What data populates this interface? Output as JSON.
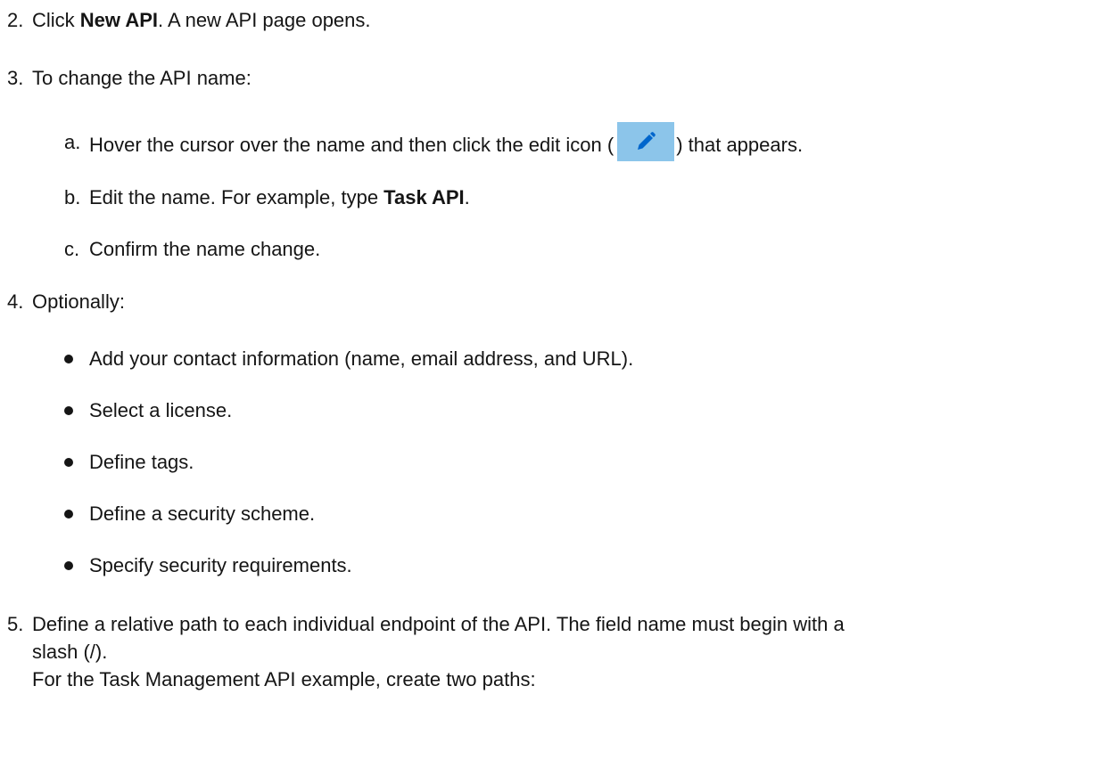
{
  "steps": [
    {
      "number": "2.",
      "text_before": "Click ",
      "bold": "New API",
      "text_after": ". A new API page opens."
    },
    {
      "number": "3.",
      "text": "To change the API name:",
      "substeps": [
        {
          "letter": "a.",
          "text_before": "Hover the cursor over the name and then click the edit icon (",
          "icon": "pencil-edit-icon",
          "text_after": ") that appears."
        },
        {
          "letter": "b.",
          "text_before": "Edit the name. For example, type ",
          "bold": "Task API",
          "text_after": "."
        },
        {
          "letter": "c.",
          "text": "Confirm the name change."
        }
      ]
    },
    {
      "number": "4.",
      "text": "Optionally:",
      "bullets": [
        "Add your contact information (name, email address, and URL).",
        "Select a license.",
        "Define tags.",
        "Define a security scheme.",
        "Specify security requirements."
      ]
    },
    {
      "number": "5.",
      "line1": "Define a relative path to each individual endpoint of the API. The field name must begin with a",
      "line2": "slash (/).",
      "line3": "For the Task Management API example, create two paths:"
    }
  ],
  "colors": {
    "text": "#151515",
    "icon_background": "#8cc5ea",
    "icon_pencil": "#0066cc"
  }
}
